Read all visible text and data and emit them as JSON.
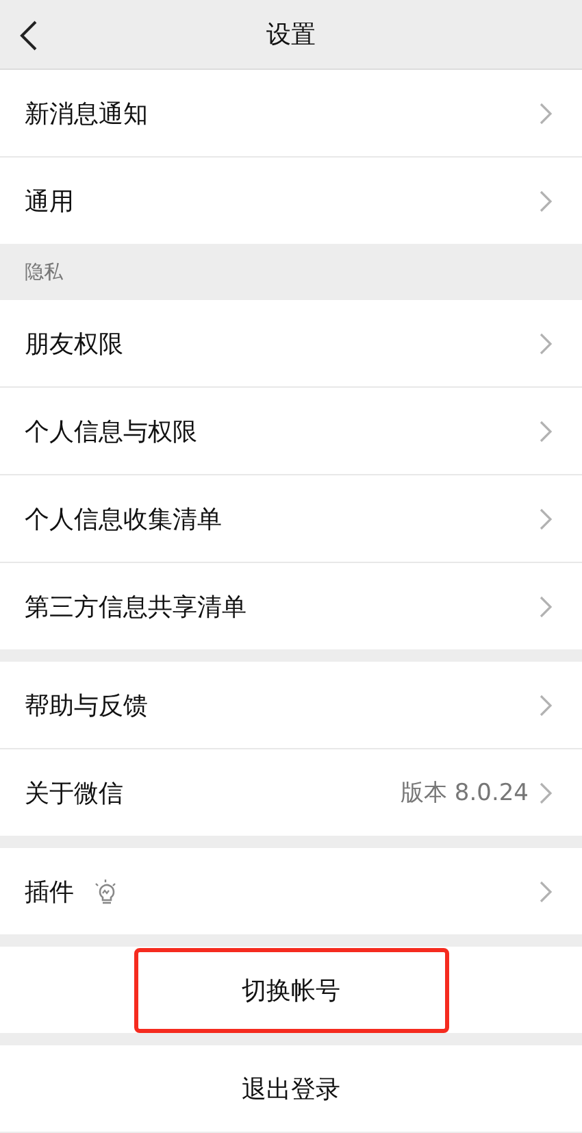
{
  "nav_bar": {
    "title": "设置"
  },
  "sections": [
    {
      "items": [
        {
          "kind": "plain",
          "label": "新消息通知"
        },
        {
          "kind": "plain",
          "label": "通用"
        }
      ]
    },
    {
      "header": "隐私",
      "items": [
        {
          "kind": "plain",
          "label": "朋友权限"
        },
        {
          "kind": "plain",
          "label": "个人信息与权限"
        },
        {
          "kind": "plain",
          "label": "个人信息收集清单"
        },
        {
          "kind": "plain",
          "label": "第三方信息共享清单"
        }
      ]
    },
    {
      "items": [
        {
          "kind": "plain",
          "label": "帮助与反馈"
        },
        {
          "kind": "value",
          "label": "关于微信",
          "value": "版本 8.0.24"
        }
      ]
    },
    {
      "items": [
        {
          "kind": "icon",
          "label": "插件"
        }
      ]
    }
  ],
  "actions": [
    {
      "label": "切换帐号",
      "highlighted": true
    },
    {
      "label": "退出登录",
      "highlighted": false
    }
  ]
}
